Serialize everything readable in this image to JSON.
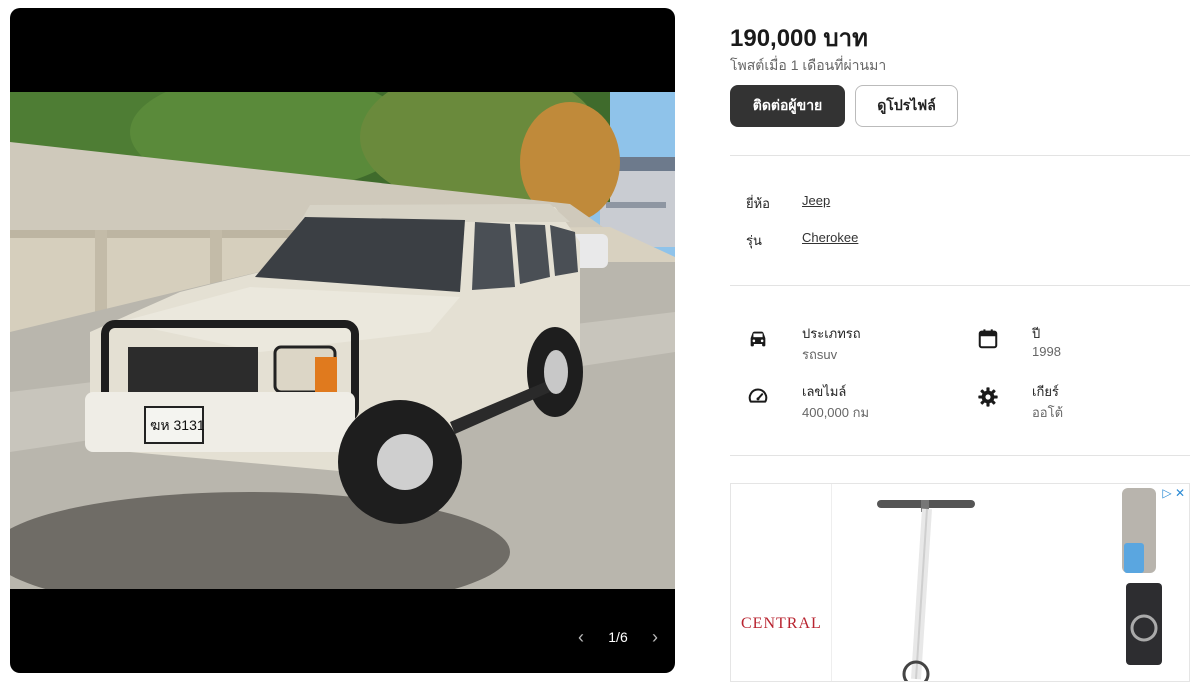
{
  "gallery": {
    "counter": "1/6",
    "prev_icon": "chevron-left-icon",
    "next_icon": "chevron-right-icon",
    "plate_text": "ฆห 3131"
  },
  "listing": {
    "price": "190,000 บาท",
    "posted": "โพสต์เมื่อ 1 เดือนที่ผ่านมา",
    "contact_label": "ติดต่อผู้ขาย",
    "profile_label": "ดูโปรไฟล์"
  },
  "specs": [
    {
      "label": "ยี่ห้อ",
      "value": "Jeep"
    },
    {
      "label": "รุ่น",
      "value": "Cherokee"
    }
  ],
  "attributes": [
    {
      "icon": "car-icon",
      "title": "ประเภทรถ",
      "value": "รถsuv"
    },
    {
      "icon": "calendar-icon",
      "title": "ปี",
      "value": "1998"
    },
    {
      "icon": "speedometer-icon",
      "title": "เลขไมล์",
      "value": "400,000 กม"
    },
    {
      "icon": "gear-icon",
      "title": "เกียร์",
      "value": "ออโต้"
    }
  ],
  "ad": {
    "brand": "CENTRAL",
    "choices_icon": "ad-choices-icon",
    "close_icon": "close-icon",
    "choices_mark": "▷",
    "close_mark": "✕"
  },
  "colors": {
    "primary_button": "#333333",
    "ad_brand": "#b8232f"
  }
}
